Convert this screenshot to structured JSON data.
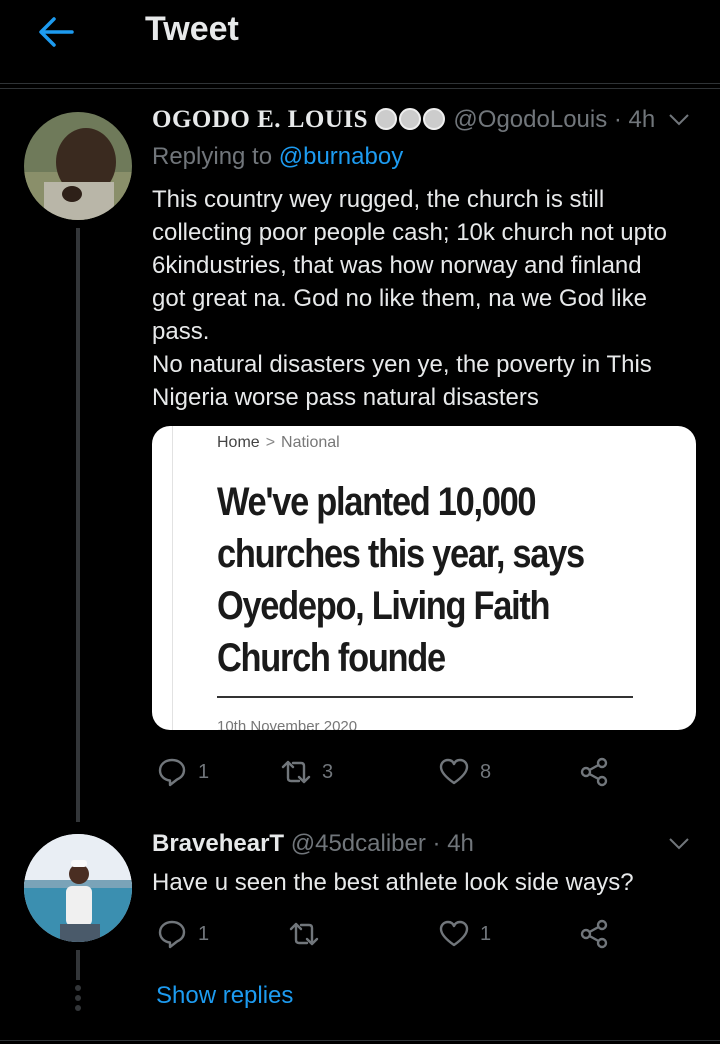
{
  "header": {
    "title": "Tweet",
    "back_icon": "arrow-left-icon",
    "accent": "#1d9bf0"
  },
  "tweet1": {
    "display_name": "OGODO E. LOUIS",
    "badges": "😊😊😊",
    "handle": "@OgodoLouis",
    "time": "· 4h",
    "replying_prefix": "Replying to",
    "replying_handle": "@burnaboy",
    "text_lines": [
      "This country wey rugged, the church is still",
      "collecting poor people cash; 10k church not upto",
      "6kindustries, that was how norway and finland",
      "got great na. God no like them, na we God like",
      "pass.",
      "No natural disasters yen ye, the poverty in This",
      "Nigeria worse pass natural disasters"
    ],
    "card": {
      "crumb_home": "Home",
      "crumb_sep": ">",
      "crumb_category": "National",
      "headline_lines": [
        "We've planted 10,000",
        "churches this year, says",
        "Oyedepo, Living Faith",
        "Church founde"
      ],
      "date": "10th November 2020"
    },
    "actions": {
      "replies": "1",
      "retweets": "3",
      "likes": "8"
    }
  },
  "tweet2": {
    "display_name": "BravehearT",
    "handle": "@45dcaliber",
    "time": "· 4h",
    "text": "Have u seen the best athlete look side ways?",
    "actions": {
      "replies": "1",
      "retweets": "",
      "likes": "1"
    }
  },
  "show_replies": "Show replies",
  "colors": {
    "background": "#000000",
    "text": "#e7e9ea",
    "muted": "#71767b",
    "link": "#1d9bf0"
  }
}
